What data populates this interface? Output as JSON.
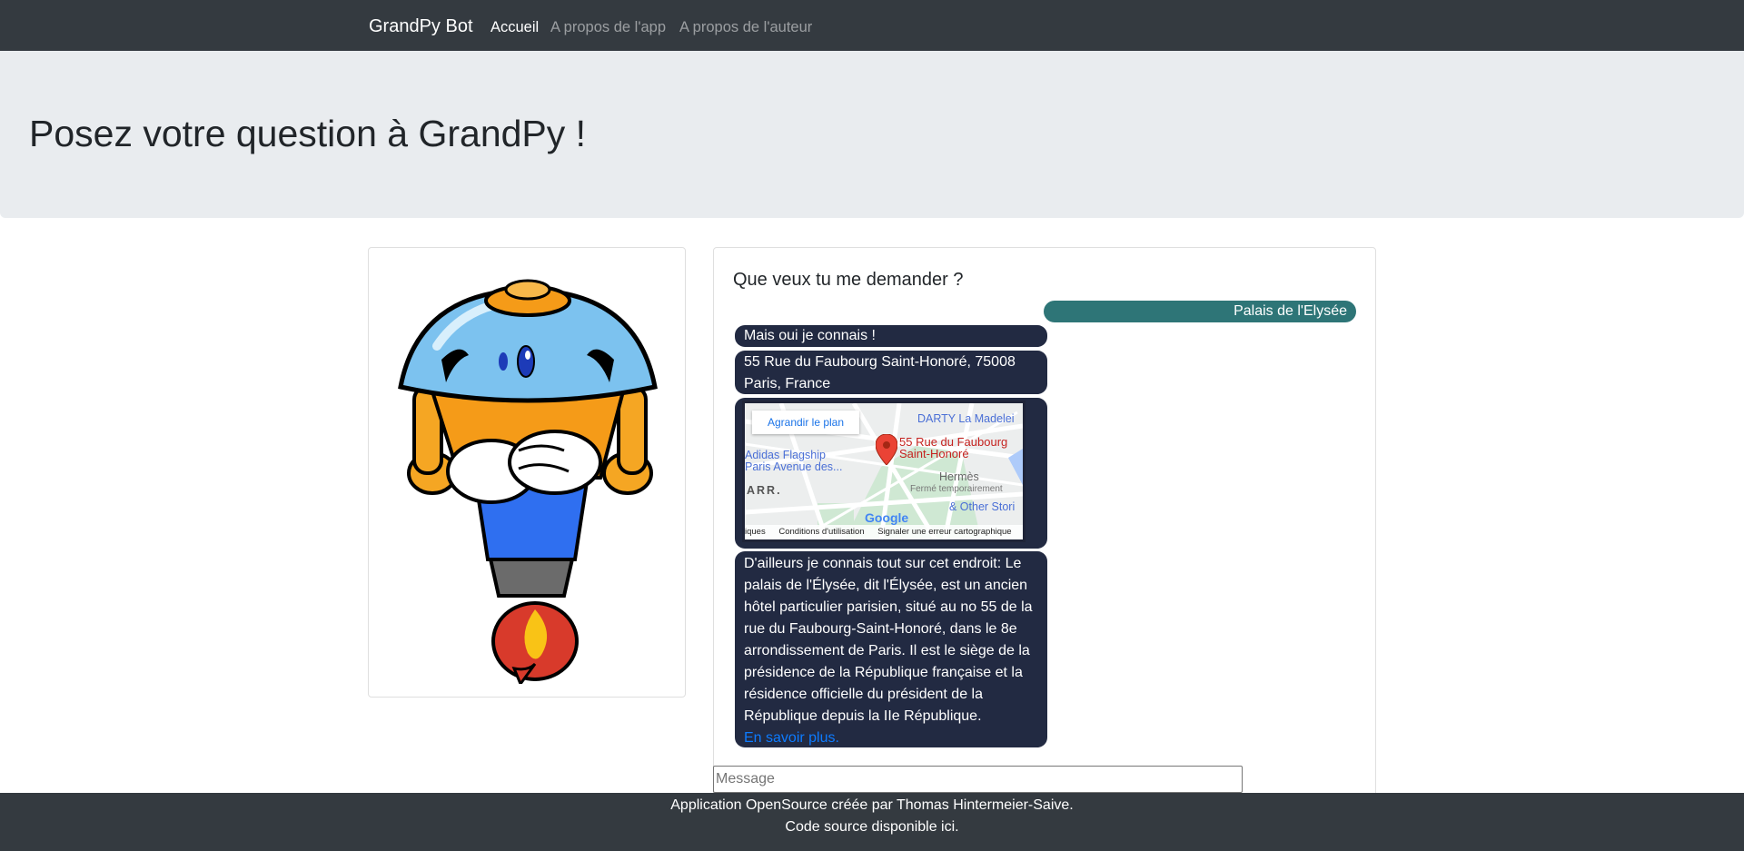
{
  "navbar": {
    "brand": "GrandPy Bot",
    "links": [
      {
        "label": "Accueil",
        "active": true
      },
      {
        "label": "A propos de l'app",
        "active": false
      },
      {
        "label": "A propos de l'auteur",
        "active": false
      }
    ]
  },
  "jumbotron": {
    "title": "Posez votre question à GrandPy !"
  },
  "chat": {
    "title": "Que veux tu me demander ?",
    "user_message": "Palais de l'Elysée",
    "bot_greeting": "Mais oui je connais !",
    "bot_address": "55 Rue du Faubourg Saint-Honoré, 75008 Paris, France",
    "bot_story": "D'ailleurs je connais tout sur cet endroit: Le palais de l'Élysée, dit l'Élysée, est un ancien hôtel particulier parisien, situé au no 55 de la rue du Faubourg-Saint-Honoré, dans le 8e arrondissement de Paris. Il est le siège de la présidence de la République française et la résidence officielle du président de la République depuis la IIe République.",
    "learn_more": "En savoir plus."
  },
  "map": {
    "enlarge_button": "Agrandir le plan",
    "marker_label_line1": "55 Rue du Faubourg",
    "marker_label_line2": "Saint-Honoré",
    "poi_darty": "DARTY La Madelei",
    "poi_adidas_line1": "Adidas Flagship",
    "poi_adidas_line2": "Paris Avenue des...",
    "poi_hermes": "Hermès",
    "poi_hermes_status": "Fermé temporairement",
    "poi_other": "& Other Stori",
    "district": "ARR.",
    "google_logo": "Google",
    "footer_keyboard": "iques",
    "footer_terms": "Conditions d'utilisation",
    "footer_report": "Signaler une erreur cartographique"
  },
  "input": {
    "placeholder": "Message"
  },
  "footer": {
    "line1": "Application OpenSource créée par Thomas Hintermeier-Saive.",
    "line2": "Code source disponible ici."
  },
  "colors": {
    "navbar": "#343a40",
    "jumbotron": "#e9ecef",
    "user_bubble": "#2e7577",
    "bot_bubble": "#222a42",
    "link": "#0d7bff"
  }
}
